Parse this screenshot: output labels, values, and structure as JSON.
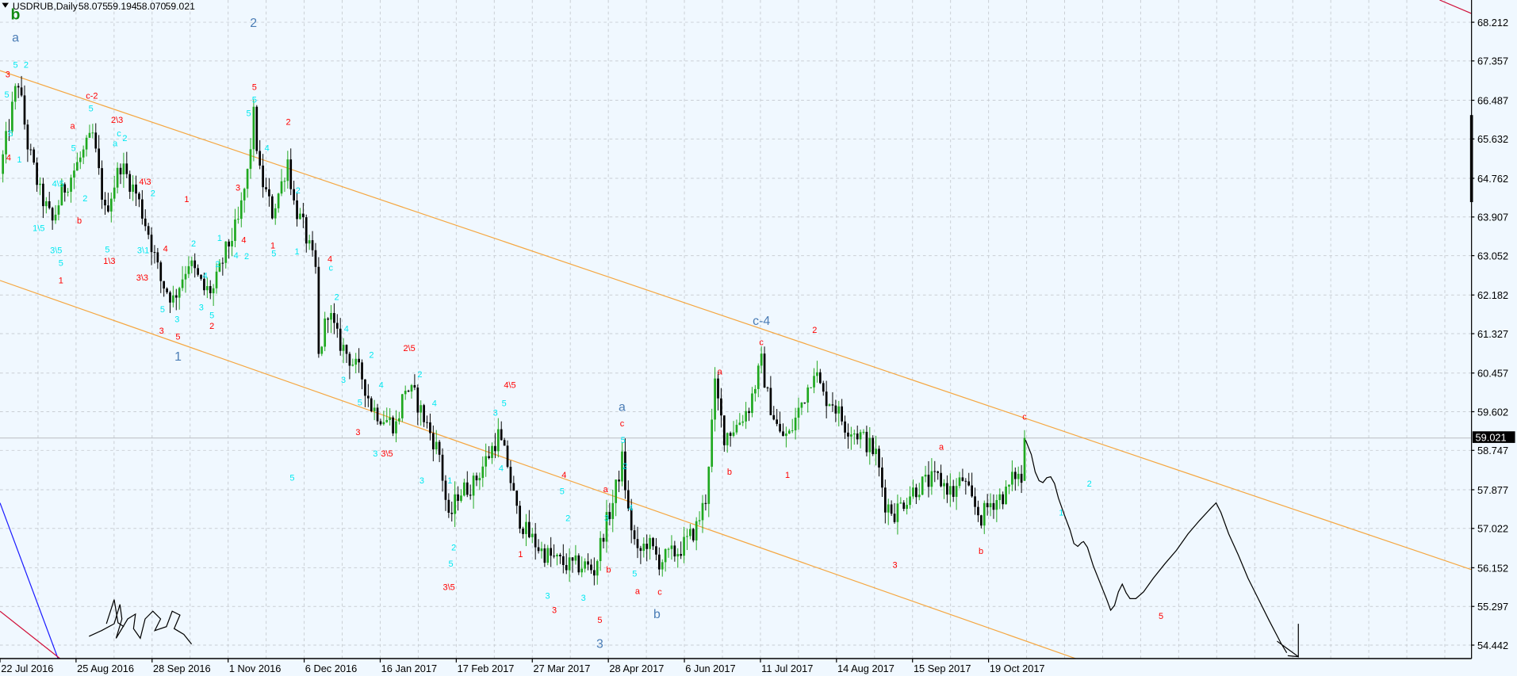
{
  "header": {
    "symbol": "USDRUB,Daily",
    "open": "58.075",
    "high": "59.194",
    "low": "58.070",
    "close": "59.021"
  },
  "price_axis": {
    "labels": [
      "68.212",
      "67.357",
      "66.487",
      "65.632",
      "64.762",
      "63.907",
      "63.052",
      "62.182",
      "61.327",
      "60.457",
      "59.602",
      "58.747",
      "57.877",
      "57.022",
      "56.152",
      "55.297",
      "54.442"
    ],
    "current_price": "59.021"
  },
  "time_axis": {
    "labels": [
      "22 Jul 2016",
      "25 Aug 2016",
      "28 Sep 2016",
      "1 Nov 2016",
      "6 Dec 2016",
      "16 Jan 2017",
      "17 Feb 2017",
      "27 Mar 2017",
      "28 Apr 2017",
      "6 Jun 2017",
      "11 Jul 2017",
      "14 Aug 2017",
      "15 Sep 2017",
      "19 Oct 2017"
    ]
  },
  "colors": {
    "bull": "#1fa81f",
    "bear": "#000000",
    "channel": "#f5a742",
    "red": "#ff0000",
    "cyan": "#00e8f0",
    "blue": "#4a7cb5",
    "green": "#108a10",
    "background": "#f0f8ff"
  },
  "chart_data": {
    "type": "candlestick",
    "title": "USDRUB,Daily",
    "ylim": [
      54.2,
      68.7
    ],
    "x_unit": "trading day index",
    "close_anchors": [
      [
        0,
        64.86
      ],
      [
        5,
        66.67
      ],
      [
        6,
        66.89
      ],
      [
        9,
        65.5
      ],
      [
        13,
        64.43
      ],
      [
        17,
        63.79
      ],
      [
        20,
        64.43
      ],
      [
        25,
        65.07
      ],
      [
        30,
        65.71
      ],
      [
        34,
        64.0
      ],
      [
        39,
        65.07
      ],
      [
        44,
        64.43
      ],
      [
        48,
        63.57
      ],
      [
        52,
        62.5
      ],
      [
        56,
        62.08
      ],
      [
        61,
        62.93
      ],
      [
        66,
        62.29
      ],
      [
        69,
        62.29
      ],
      [
        73,
        63.15
      ],
      [
        77,
        63.79
      ],
      [
        80,
        64.86
      ],
      [
        82,
        66.14
      ],
      [
        84,
        64.86
      ],
      [
        88,
        64.0
      ],
      [
        91,
        64.64
      ],
      [
        93,
        65.18
      ],
      [
        95,
        64.21
      ],
      [
        98,
        63.68
      ],
      [
        102,
        62.72
      ],
      [
        103,
        60.79
      ],
      [
        106,
        61.86
      ],
      [
        109,
        61.22
      ],
      [
        113,
        60.79
      ],
      [
        117,
        60.37
      ],
      [
        120,
        59.72
      ],
      [
        123,
        59.51
      ],
      [
        128,
        59.3
      ],
      [
        131,
        60.15
      ],
      [
        134,
        59.94
      ],
      [
        138,
        59.3
      ],
      [
        142,
        58.66
      ],
      [
        145,
        57.16
      ],
      [
        148,
        57.8
      ],
      [
        153,
        58.01
      ],
      [
        158,
        58.66
      ],
      [
        161,
        59.08
      ],
      [
        164,
        58.44
      ],
      [
        167,
        57.37
      ],
      [
        170,
        56.95
      ],
      [
        175,
        56.52
      ],
      [
        180,
        56.3
      ],
      [
        184,
        56.2
      ],
      [
        189,
        56.2
      ],
      [
        192,
        56.09
      ],
      [
        195,
        56.95
      ],
      [
        198,
        57.59
      ],
      [
        201,
        58.55
      ],
      [
        203,
        57.37
      ],
      [
        206,
        56.41
      ],
      [
        209,
        56.73
      ],
      [
        213,
        56.3
      ],
      [
        216,
        56.41
      ],
      [
        219,
        56.52
      ],
      [
        222,
        56.73
      ],
      [
        225,
        57.05
      ],
      [
        228,
        57.69
      ],
      [
        231,
        60.15
      ],
      [
        234,
        59.08
      ],
      [
        238,
        59.3
      ],
      [
        242,
        59.72
      ],
      [
        246,
        60.69
      ],
      [
        248,
        59.94
      ],
      [
        252,
        59.08
      ],
      [
        255,
        59.08
      ],
      [
        258,
        59.62
      ],
      [
        261,
        60.15
      ],
      [
        263,
        60.58
      ],
      [
        266,
        59.94
      ],
      [
        269,
        59.83
      ],
      [
        273,
        59.3
      ],
      [
        278,
        59.08
      ],
      [
        283,
        58.66
      ],
      [
        286,
        57.59
      ],
      [
        289,
        57.37
      ],
      [
        294,
        57.8
      ],
      [
        298,
        58.01
      ],
      [
        303,
        58.12
      ],
      [
        308,
        57.8
      ],
      [
        311,
        58.12
      ],
      [
        314,
        57.59
      ],
      [
        317,
        57.26
      ],
      [
        320,
        57.59
      ],
      [
        325,
        57.8
      ],
      [
        328,
        58.23
      ],
      [
        330,
        58.075
      ]
    ],
    "last_bar": {
      "open": 58.075,
      "high": 59.194,
      "low": 58.07,
      "close": 59.021
    }
  },
  "wave_labels": [
    {
      "t": "b",
      "c": "green"
    },
    {
      "t": "a",
      "c": "blue"
    },
    {
      "t": "2",
      "c": "blue"
    },
    {
      "t": "1",
      "c": "blue"
    },
    {
      "t": "c-4",
      "c": "blue"
    },
    {
      "t": "a",
      "c": "blue"
    },
    {
      "t": "b",
      "c": "blue"
    },
    {
      "t": "3",
      "c": "blue"
    },
    {
      "t": "3",
      "c": "red"
    },
    {
      "t": "4",
      "c": "red"
    },
    {
      "t": "c-2",
      "c": "red"
    },
    {
      "t": "a",
      "c": "red"
    },
    {
      "t": "2\\3",
      "c": "red"
    },
    {
      "t": "4\\3",
      "c": "red"
    },
    {
      "t": "b",
      "c": "red"
    },
    {
      "t": "1\\3",
      "c": "red"
    },
    {
      "t": "1",
      "c": "red"
    },
    {
      "t": "3\\3",
      "c": "red"
    },
    {
      "t": "4",
      "c": "red"
    },
    {
      "t": "1",
      "c": "red"
    },
    {
      "t": "3",
      "c": "red"
    },
    {
      "t": "5",
      "c": "red"
    },
    {
      "t": "2",
      "c": "red"
    },
    {
      "t": "3",
      "c": "red"
    },
    {
      "t": "4",
      "c": "red"
    },
    {
      "t": "5",
      "c": "red"
    },
    {
      "t": "2",
      "c": "red"
    },
    {
      "t": "1",
      "c": "red"
    },
    {
      "t": "4",
      "c": "red"
    },
    {
      "t": "3",
      "c": "red"
    },
    {
      "t": "2\\5",
      "c": "red"
    },
    {
      "t": "3\\5",
      "c": "red"
    },
    {
      "t": "4\\5",
      "c": "red"
    },
    {
      "t": "3\\5",
      "c": "red"
    },
    {
      "t": "1",
      "c": "red"
    },
    {
      "t": "4",
      "c": "red"
    },
    {
      "t": "3",
      "c": "red"
    },
    {
      "t": "5",
      "c": "red"
    },
    {
      "t": "a",
      "c": "red"
    },
    {
      "t": "c",
      "c": "red"
    },
    {
      "t": "b",
      "c": "red"
    },
    {
      "t": "a",
      "c": "red"
    },
    {
      "t": "c",
      "c": "red"
    },
    {
      "t": "a",
      "c": "red"
    },
    {
      "t": "b",
      "c": "red"
    },
    {
      "t": "c",
      "c": "red"
    },
    {
      "t": "2",
      "c": "red"
    },
    {
      "t": "1",
      "c": "red"
    },
    {
      "t": "a",
      "c": "red"
    },
    {
      "t": "3",
      "c": "red"
    },
    {
      "t": "b",
      "c": "red"
    },
    {
      "t": "c",
      "c": "red"
    },
    {
      "t": "5",
      "c": "red"
    },
    {
      "t": "5",
      "c": "cyan"
    },
    {
      "t": "2",
      "c": "cyan"
    },
    {
      "t": "5",
      "c": "cyan"
    },
    {
      "t": "5",
      "c": "cyan"
    },
    {
      "t": "1",
      "c": "cyan"
    },
    {
      "t": "1\\5",
      "c": "cyan"
    },
    {
      "t": "3\\5",
      "c": "cyan"
    },
    {
      "t": "5",
      "c": "cyan"
    },
    {
      "t": "5",
      "c": "cyan"
    },
    {
      "t": "4\\5",
      "c": "cyan"
    },
    {
      "t": "5",
      "c": "cyan"
    },
    {
      "t": "2",
      "c": "cyan"
    },
    {
      "t": "5",
      "c": "cyan"
    },
    {
      "t": "a",
      "c": "cyan"
    },
    {
      "t": "c",
      "c": "cyan"
    },
    {
      "t": "2",
      "c": "cyan"
    },
    {
      "t": "2",
      "c": "cyan"
    },
    {
      "t": "3\\1",
      "c": "cyan"
    },
    {
      "t": "5",
      "c": "cyan"
    },
    {
      "t": "3",
      "c": "cyan"
    },
    {
      "t": "2",
      "c": "cyan"
    },
    {
      "t": "3",
      "c": "cyan"
    },
    {
      "t": "4",
      "c": "cyan"
    },
    {
      "t": "5",
      "c": "cyan"
    },
    {
      "t": "2",
      "c": "cyan"
    },
    {
      "t": "1",
      "c": "cyan"
    },
    {
      "t": "4",
      "c": "cyan"
    },
    {
      "t": "2",
      "c": "cyan"
    },
    {
      "t": "5",
      "c": "cyan"
    },
    {
      "t": "5",
      "c": "cyan"
    },
    {
      "t": "4",
      "c": "cyan"
    },
    {
      "t": "5",
      "c": "cyan"
    },
    {
      "t": "2",
      "c": "cyan"
    },
    {
      "t": "1",
      "c": "cyan"
    },
    {
      "t": "5",
      "c": "cyan"
    },
    {
      "t": "c",
      "c": "cyan"
    },
    {
      "t": "2",
      "c": "cyan"
    },
    {
      "t": "4",
      "c": "cyan"
    },
    {
      "t": "2",
      "c": "cyan"
    },
    {
      "t": "3",
      "c": "cyan"
    },
    {
      "t": "4",
      "c": "cyan"
    },
    {
      "t": "5",
      "c": "cyan"
    },
    {
      "t": "3",
      "c": "cyan"
    },
    {
      "t": "4",
      "c": "cyan"
    },
    {
      "t": "2",
      "c": "cyan"
    },
    {
      "t": "3",
      "c": "cyan"
    },
    {
      "t": "2",
      "c": "cyan"
    },
    {
      "t": "5",
      "c": "cyan"
    },
    {
      "t": "1",
      "c": "cyan"
    },
    {
      "t": "3",
      "c": "cyan"
    },
    {
      "t": "5",
      "c": "cyan"
    },
    {
      "t": "4",
      "c": "cyan"
    },
    {
      "t": "5",
      "c": "cyan"
    },
    {
      "t": "2",
      "c": "cyan"
    },
    {
      "t": "3",
      "c": "cyan"
    },
    {
      "t": "3",
      "c": "cyan"
    },
    {
      "t": "5",
      "c": "cyan"
    },
    {
      "t": "2",
      "c": "cyan"
    },
    {
      "t": "3",
      "c": "cyan"
    },
    {
      "t": "4",
      "c": "cyan"
    },
    {
      "t": "5",
      "c": "cyan"
    },
    {
      "t": "2",
      "c": "cyan"
    },
    {
      "t": "1",
      "c": "cyan"
    }
  ],
  "signature": "ARS"
}
